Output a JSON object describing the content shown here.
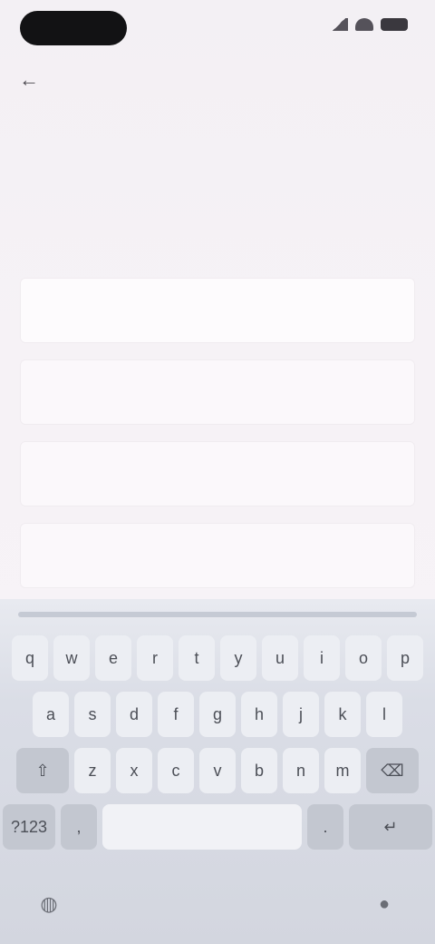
{
  "status_bar": {
    "icons": [
      "signal-icon",
      "wifi-icon",
      "battery-icon"
    ]
  },
  "app_bar": {
    "back_icon": "arrow-left-icon",
    "back_glyph": "←",
    "title": ""
  },
  "hero": {
    "title_main": "",
    "title_accent": ""
  },
  "section_heading": "",
  "fields": [
    {
      "placeholder": ""
    },
    {
      "placeholder": ""
    },
    {
      "placeholder": ""
    },
    {
      "placeholder": ""
    }
  ],
  "keyboard": {
    "row1": [
      "q",
      "w",
      "e",
      "r",
      "t",
      "y",
      "u",
      "i",
      "o",
      "p"
    ],
    "row2": [
      "a",
      "s",
      "d",
      "f",
      "g",
      "h",
      "j",
      "k",
      "l"
    ],
    "row3": [
      "z",
      "x",
      "c",
      "v",
      "b",
      "n",
      "m"
    ],
    "shift_glyph": "⇧",
    "backspace_glyph": "⌫",
    "symbols_label": "?123",
    "comma_label": ",",
    "space_label": "",
    "period_label": ".",
    "enter_glyph": "↵",
    "globe_glyph": "◍",
    "mic_glyph": "●"
  },
  "colors": {
    "background": "#f6f2f6",
    "accent": "#d98e9c",
    "keyboard": "#d8dbe4"
  }
}
